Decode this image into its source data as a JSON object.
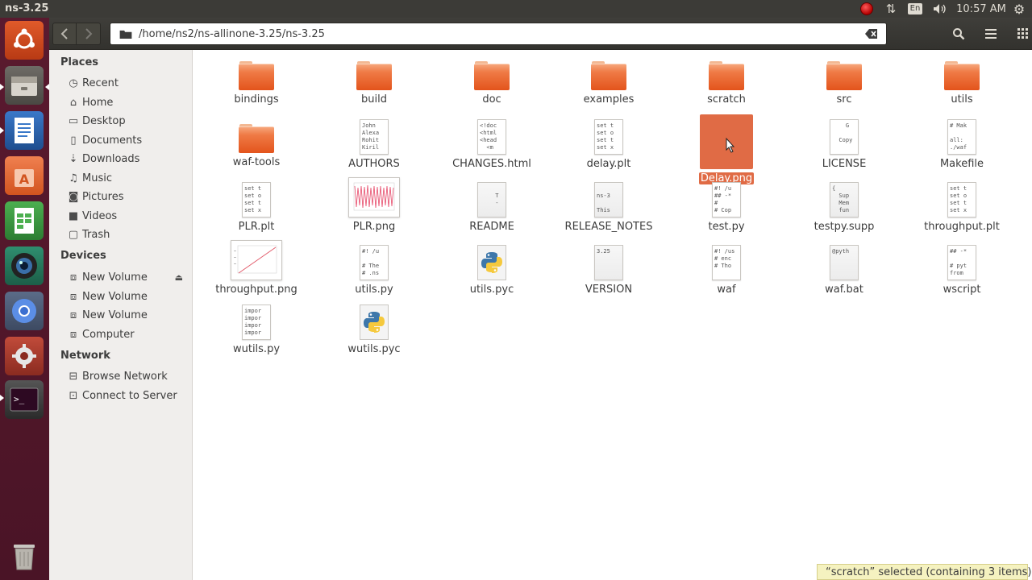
{
  "window": {
    "title": "ns-3.25"
  },
  "tray": {
    "keyboard": "En",
    "clock": "10:57 AM"
  },
  "launcher": {
    "items": [
      "ubuntu-home",
      "files",
      "libreoffice-writer",
      "software-center",
      "libreoffice-calc",
      "webcam",
      "chromium",
      "system-settings",
      "terminal",
      "trash"
    ]
  },
  "location": {
    "path": "/home/ns2/ns-allinone-3.25/ns-3.25"
  },
  "sidebar": {
    "places_heading": "Places",
    "places": [
      {
        "label": "Recent",
        "icon": "clock-icon"
      },
      {
        "label": "Home",
        "icon": "home-icon"
      },
      {
        "label": "Desktop",
        "icon": "folder-icon"
      },
      {
        "label": "Documents",
        "icon": "document-icon"
      },
      {
        "label": "Downloads",
        "icon": "download-icon"
      },
      {
        "label": "Music",
        "icon": "music-icon"
      },
      {
        "label": "Pictures",
        "icon": "camera-icon"
      },
      {
        "label": "Videos",
        "icon": "video-icon"
      },
      {
        "label": "Trash",
        "icon": "trash-icon"
      }
    ],
    "devices_heading": "Devices",
    "devices": [
      {
        "label": "New Volume",
        "icon": "drive-icon"
      },
      {
        "label": "New Volume",
        "icon": "drive-icon"
      },
      {
        "label": "New Volume",
        "icon": "drive-icon"
      },
      {
        "label": "Computer",
        "icon": "drive-icon"
      }
    ],
    "network_heading": "Network",
    "network": [
      {
        "label": "Browse Network",
        "icon": "network-icon"
      },
      {
        "label": "Connect to Server",
        "icon": "server-icon"
      }
    ]
  },
  "files": [
    {
      "name": "bindings",
      "type": "folder"
    },
    {
      "name": "build",
      "type": "folder"
    },
    {
      "name": "doc",
      "type": "folder"
    },
    {
      "name": "examples",
      "type": "folder"
    },
    {
      "name": "scratch",
      "type": "folder"
    },
    {
      "name": "src",
      "type": "folder"
    },
    {
      "name": "utils",
      "type": "folder"
    },
    {
      "name": "waf-tools",
      "type": "folder"
    },
    {
      "name": "AUTHORS",
      "type": "text",
      "preview": "John \nAlexa\nRohit\nKiril"
    },
    {
      "name": "CHANGES.html",
      "type": "text",
      "preview": "<!doc\n<html\n<head\n  <m"
    },
    {
      "name": "delay.plt",
      "type": "text",
      "preview": "set t\nset o\nset t\nset x"
    },
    {
      "name": "Delay.png",
      "type": "image",
      "selected": true
    },
    {
      "name": "LICENSE",
      "type": "text",
      "preview": "    G\n\n  Copy"
    },
    {
      "name": "Makefile",
      "type": "text",
      "preview": "# Mak\n\nall:\n./waf"
    },
    {
      "name": "PLR.plt",
      "type": "text",
      "preview": "set t\nset o\nset t\nset x"
    },
    {
      "name": "PLR.png",
      "type": "image"
    },
    {
      "name": "README",
      "type": "text",
      "preview": "\n   T\n   -"
    },
    {
      "name": "RELEASE_NOTES",
      "type": "text",
      "preview": "\nns-3\n\nThis"
    },
    {
      "name": "test.py",
      "type": "text",
      "preview": "#! /u\n## -*\n#\n# Cop"
    },
    {
      "name": "testpy.supp",
      "type": "text",
      "preview": "{\n  Sup\n  Mem\n  fun"
    },
    {
      "name": "throughput.plt",
      "type": "text",
      "preview": "set t\nset o\nset t\nset x"
    },
    {
      "name": "throughput.png",
      "type": "image"
    },
    {
      "name": "utils.py",
      "type": "text",
      "preview": "#! /u\n\n# The\n# .ns"
    },
    {
      "name": "utils.pyc",
      "type": "python"
    },
    {
      "name": "VERSION",
      "type": "text",
      "preview": "3.25"
    },
    {
      "name": "waf",
      "type": "text",
      "preview": "#! /us\n# enc\n# Tho"
    },
    {
      "name": "waf.bat",
      "type": "text",
      "preview": "@pyth"
    },
    {
      "name": "wscript",
      "type": "text",
      "preview": "## -*\n\n# pyt\nfrom"
    },
    {
      "name": "wutils.py",
      "type": "text",
      "preview": "impor\nimpor\nimpor\nimpor"
    },
    {
      "name": "wutils.pyc",
      "type": "python"
    }
  ],
  "status": {
    "text": "“scratch” selected  (containing 3 items)"
  },
  "colors": {
    "accent": "#e06b45",
    "panel": "#3c3b37",
    "launcher": "#5a1a2f"
  }
}
